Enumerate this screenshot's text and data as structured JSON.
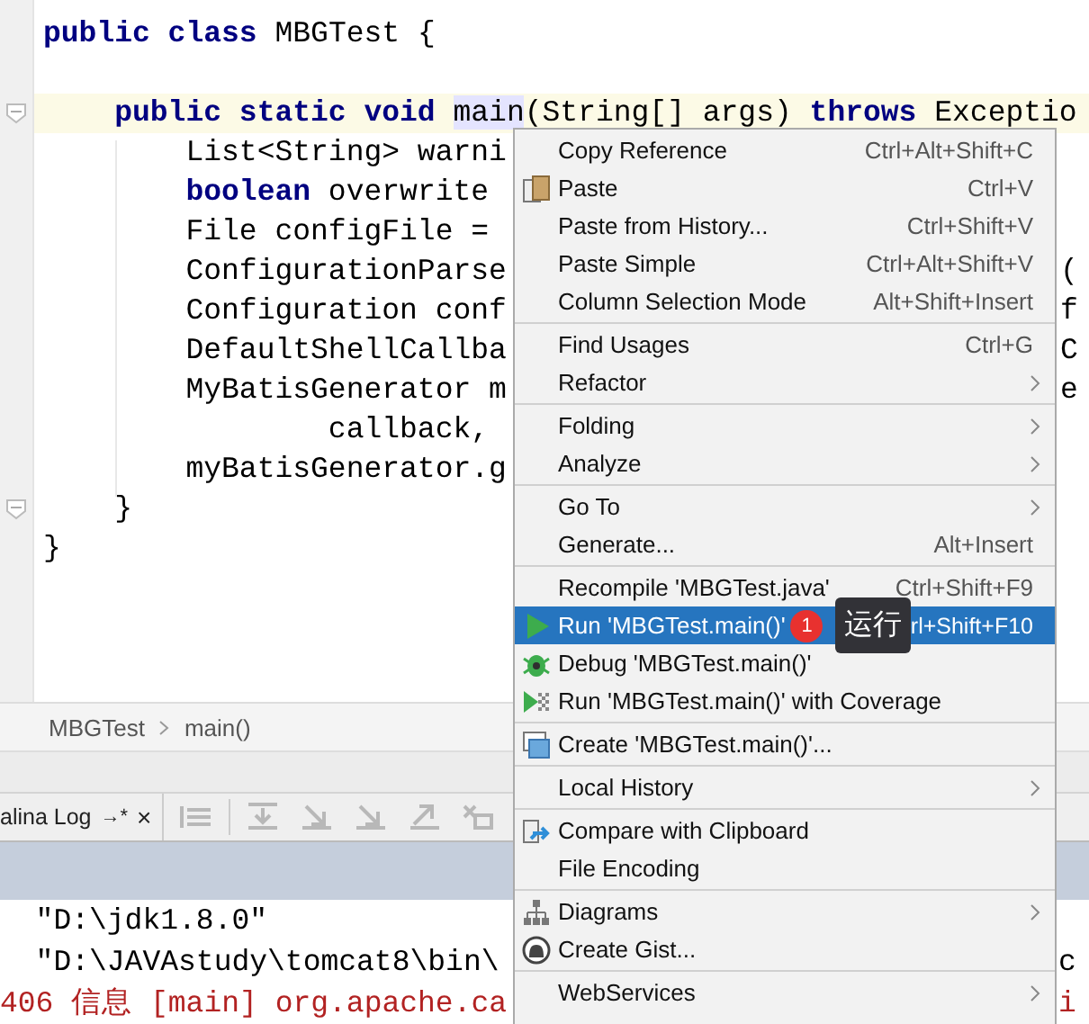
{
  "editor": {
    "lines": [
      {
        "segments": [
          {
            "text": "public class ",
            "kind": "keyword"
          },
          {
            "text": "MBGTest {",
            "kind": "plain"
          }
        ],
        "current": false,
        "fold": false
      },
      {
        "current": false,
        "fold": false
      },
      {
        "segments": [
          {
            "text": "    public static void ",
            "kind": "keyword"
          },
          {
            "text": "main",
            "kind": "usage"
          },
          {
            "text": "(String[] args) ",
            "kind": "plain"
          },
          {
            "text": "throws",
            "kind": "keyword"
          },
          {
            "text": " Exceptio",
            "kind": "plain"
          }
        ],
        "current": true,
        "fold": true
      },
      {
        "segments": [
          {
            "text": "        List<String> warni",
            "kind": "plain"
          }
        ],
        "current": false,
        "fold": false
      },
      {
        "segments": [
          {
            "text": "        boolean",
            "kind": "keyword"
          },
          {
            "text": " overwrite",
            "kind": "plain"
          }
        ],
        "current": false,
        "fold": false
      },
      {
        "segments": [
          {
            "text": "        File configFile =",
            "kind": "plain"
          }
        ],
        "current": false,
        "fold": false
      },
      {
        "segments": [
          {
            "text": "        ConfigurationParse",
            "kind": "plain"
          }
        ],
        "tail": "(",
        "current": false,
        "fold": false
      },
      {
        "segments": [
          {
            "text": "        Configuration conf",
            "kind": "plain"
          }
        ],
        "tail": "f",
        "current": false,
        "fold": false
      },
      {
        "segments": [
          {
            "text": "        DefaultShellCallba",
            "kind": "plain"
          }
        ],
        "tail": "C",
        "current": false,
        "fold": false
      },
      {
        "segments": [
          {
            "text": "        MyBatisGenerator m",
            "kind": "plain"
          }
        ],
        "tail": "e",
        "current": false,
        "fold": false
      },
      {
        "segments": [
          {
            "text": "                callback,",
            "kind": "plain"
          }
        ],
        "current": false,
        "fold": false
      },
      {
        "segments": [
          {
            "text": "        myBatisGenerator.g",
            "kind": "plain"
          }
        ],
        "current": false,
        "fold": false
      },
      {
        "segments": [
          {
            "text": "    }",
            "kind": "plain"
          }
        ],
        "current": false,
        "fold": true
      },
      {
        "segments": [
          {
            "text": "}",
            "kind": "plain"
          }
        ],
        "current": false,
        "fold": false
      }
    ]
  },
  "breadcrumb": [
    "MBGTest",
    "main()"
  ],
  "run_panel": {
    "tab": {
      "label": "alina Log",
      "pin": "→*",
      "close": "×"
    },
    "console": [
      {
        "text": "  \"D:\\jdk1.8.0\"",
        "kind": "plain"
      },
      {
        "text": "  \"D:\\JAVAstudy\\tomcat8\\bin\\",
        "tail": "c",
        "kind": "plain"
      },
      {
        "text": "406 信息 [main] org.apache.ca",
        "tail": "i",
        "kind": "log"
      }
    ]
  },
  "context_menu": {
    "groups": [
      [
        {
          "label": "Copy Reference",
          "shortcut": "Ctrl+Alt+Shift+C",
          "submenu": false,
          "selected": false
        },
        {
          "label": "Paste",
          "shortcut": "Ctrl+V",
          "submenu": false,
          "selected": false,
          "kind": "paste"
        },
        {
          "label": "Paste from History...",
          "shortcut": "Ctrl+Shift+V",
          "submenu": false,
          "selected": false
        },
        {
          "label": "Paste Simple",
          "shortcut": "Ctrl+Alt+Shift+V",
          "submenu": false,
          "selected": false
        },
        {
          "label": "Column Selection Mode",
          "shortcut": "Alt+Shift+Insert",
          "submenu": false,
          "selected": false
        }
      ],
      [
        {
          "label": "Find Usages",
          "shortcut": "Ctrl+G",
          "submenu": false,
          "selected": false
        },
        {
          "label": "Refactor",
          "submenu": true,
          "selected": false
        }
      ],
      [
        {
          "label": "Folding",
          "submenu": true,
          "selected": false
        },
        {
          "label": "Analyze",
          "submenu": true,
          "selected": false
        }
      ],
      [
        {
          "label": "Go To",
          "submenu": true,
          "selected": false
        },
        {
          "label": "Generate...",
          "shortcut": "Alt+Insert",
          "submenu": false,
          "selected": false
        }
      ],
      [
        {
          "label": "Recompile 'MBGTest.java'",
          "shortcut": "Ctrl+Shift+F9",
          "submenu": false,
          "selected": false
        },
        {
          "label": "Run 'MBGTest.main()'",
          "shortcut": "rl+Shift+F10",
          "submenu": false,
          "selected": true,
          "kind": "run",
          "badge": "1",
          "tooltip": "运行"
        },
        {
          "label": "Debug 'MBGTest.main()'",
          "submenu": false,
          "selected": false,
          "kind": "debug"
        },
        {
          "label": "Run 'MBGTest.main()' with Coverage",
          "submenu": false,
          "selected": false,
          "kind": "coverage"
        }
      ],
      [
        {
          "label": "Create 'MBGTest.main()'...",
          "submenu": false,
          "selected": false,
          "kind": "create"
        }
      ],
      [
        {
          "label": "Local History",
          "submenu": true,
          "selected": false
        }
      ],
      [
        {
          "label": "Compare with Clipboard",
          "submenu": false,
          "selected": false,
          "kind": "compare"
        },
        {
          "label": "File Encoding",
          "submenu": false,
          "selected": false
        }
      ],
      [
        {
          "label": "Diagrams",
          "submenu": true,
          "selected": false,
          "kind": "diagrams"
        },
        {
          "label": "Create Gist...",
          "submenu": false,
          "selected": false,
          "kind": "gist"
        }
      ],
      [
        {
          "label": "WebServices",
          "submenu": true,
          "selected": false
        }
      ]
    ]
  }
}
